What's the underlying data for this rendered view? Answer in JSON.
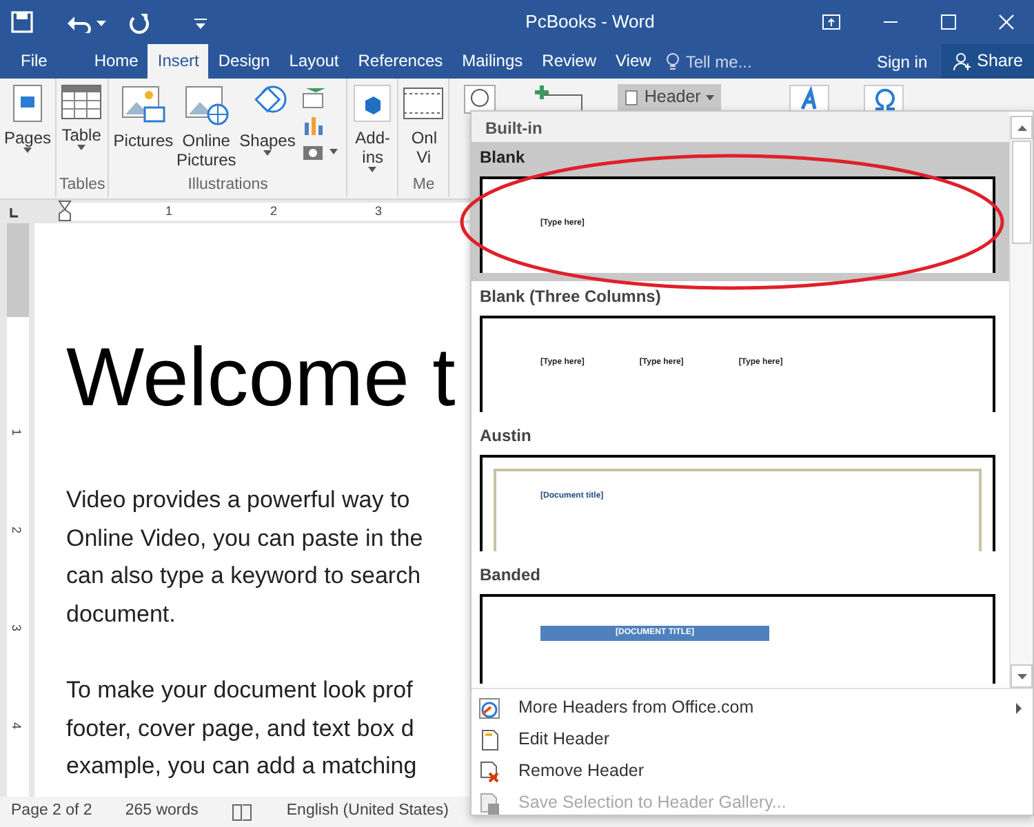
{
  "window": {
    "title": "PcBooks - Word"
  },
  "tabs": [
    {
      "label": "File",
      "selected": false
    },
    {
      "label": "Home",
      "selected": false
    },
    {
      "label": "Insert",
      "selected": true
    },
    {
      "label": "Design",
      "selected": false
    },
    {
      "label": "Layout",
      "selected": false
    },
    {
      "label": "References",
      "selected": false
    },
    {
      "label": "Mailings",
      "selected": false
    },
    {
      "label": "Review",
      "selected": false
    },
    {
      "label": "View",
      "selected": false
    }
  ],
  "tell_me": "Tell me...",
  "sign_in": "Sign in",
  "share": "Share",
  "ribbon": {
    "groups": [
      {
        "buttons": [
          {
            "label": "Pages",
            "kind": "pages",
            "caret": true
          }
        ]
      },
      {
        "label": "Tables",
        "buttons": [
          {
            "label": "Table",
            "kind": "table",
            "caret": true
          }
        ]
      },
      {
        "label": "Illustrations",
        "buttons": [
          {
            "label": "Pictures",
            "kind": "pictures",
            "caret": false
          },
          {
            "label": "Online Pictures",
            "kind": "online-pictures",
            "caret": false
          },
          {
            "label": "Shapes",
            "kind": "shapes",
            "caret": true
          },
          {
            "kind": "small-stack",
            "caret": true
          }
        ]
      },
      {
        "buttons": [
          {
            "label": "Add-ins",
            "kind": "addins",
            "caret": true
          }
        ]
      },
      {
        "label": "Me",
        "buttons": [
          {
            "label": "Onl Vi",
            "kind": "video",
            "caret": false
          }
        ]
      }
    ],
    "header_button": {
      "label": "Header",
      "selected": true
    }
  },
  "ruler": {
    "horizontal": [
      "1",
      "2",
      "3"
    ],
    "vertical": [
      "1",
      "2",
      "3",
      "4"
    ]
  },
  "document": {
    "title": "Welcome t",
    "paragraphs": [
      [
        "Video provides a powerful way to",
        "Online Video, you can paste in the",
        "can also type a keyword to search",
        "document."
      ],
      [
        "To make your document look prof",
        "footer, cover page, and text box d",
        "example, you can add a matching"
      ]
    ]
  },
  "status_bar": {
    "page": "Page 2 of 2",
    "words": "265 words",
    "language": "English (United States)"
  },
  "header_menu": {
    "section": "Built-in",
    "gallery": [
      {
        "title": "Blank",
        "selected": true,
        "kind": "blank",
        "placeholders": [
          "[Type here]"
        ]
      },
      {
        "title": "Blank (Three Columns)",
        "selected": false,
        "kind": "columns",
        "placeholders": [
          "[Type here]",
          "[Type here]",
          "[Type here]"
        ]
      },
      {
        "title": "Austin",
        "selected": false,
        "kind": "austin",
        "placeholders": [
          "[Document title]"
        ]
      },
      {
        "title": "Banded",
        "selected": false,
        "kind": "banded",
        "placeholders": [
          "[DOCUMENT TITLE]"
        ]
      }
    ],
    "commands": [
      {
        "label": "More Headers from Office.com",
        "kind": "office",
        "submenu": true,
        "disabled": false
      },
      {
        "label": "Edit Header",
        "kind": "edit",
        "submenu": false,
        "disabled": false
      },
      {
        "label": "Remove Header",
        "kind": "remove",
        "submenu": false,
        "disabled": false
      },
      {
        "label": "Save Selection to Header Gallery...",
        "kind": "save",
        "submenu": false,
        "disabled": true
      }
    ]
  },
  "annotation": {
    "kind": "ellipse"
  }
}
